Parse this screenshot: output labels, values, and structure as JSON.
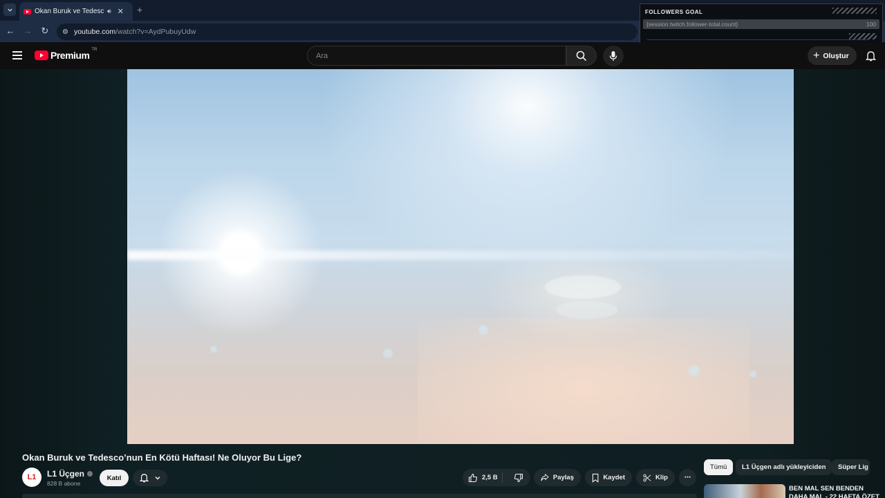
{
  "browser": {
    "tab_title": "Okan Buruk ve Tedesco'nun En Kötü Haftası! Ne Oluyor Bu Lige? - YouTube",
    "url_host": "youtube.com",
    "url_path": "/watch?v=AydPubuyUdw"
  },
  "overlay": {
    "title": "FOLLOWERS GOAL",
    "placeholder": "{session.twitch.follower-total.count}",
    "goal": "100"
  },
  "header": {
    "logo_text": "Premium",
    "region": "TR",
    "search_placeholder": "Ara",
    "create_label": "Oluştur"
  },
  "video": {
    "title": "Okan Buruk ve Tedesco’nun En Kötü Haftası! Ne Oluyor Bu Lige?",
    "channel": {
      "avatar_text": "L1",
      "name": "L1 Üçgen",
      "subscribers": "828 B abone"
    },
    "join_label": "Katıl",
    "actions": {
      "likes": "2,5 B",
      "share": "Paylaş",
      "save": "Kaydet",
      "clip": "Klip"
    }
  },
  "related": {
    "chips": [
      "Tümü",
      "L1 Üçgen adlı yükleyiciden",
      "Süper Lig"
    ],
    "first_title": "BEN MAL SEN BENDEN DAHA MAL - 22 HAFTA ÖZET"
  }
}
